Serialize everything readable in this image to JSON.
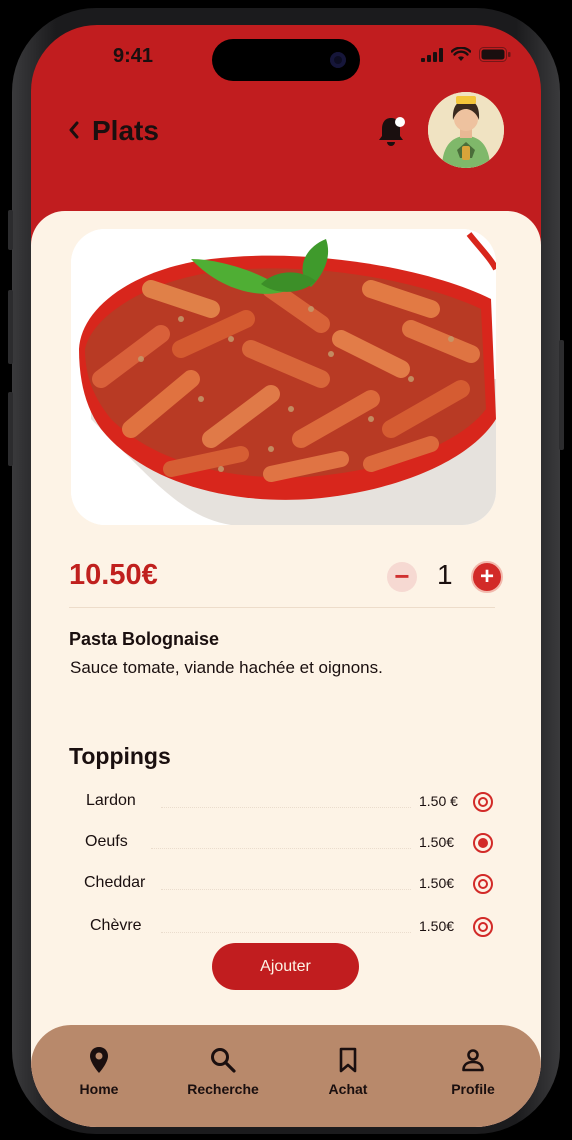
{
  "status_bar": {
    "time": "9:41"
  },
  "header": {
    "back_icon": "chevron-left-icon",
    "title": "Plats",
    "notification_icon": "bell-icon"
  },
  "dish": {
    "price": "10.50€",
    "quantity": "1",
    "name": "Pasta Bolognaise",
    "description": "Sauce tomate, viande hachée et oignons.",
    "image": "penne-bolognese-bowl"
  },
  "toppings": {
    "title": "Toppings",
    "items": [
      {
        "name": "Lardon",
        "price": "1.50 €",
        "selected": false
      },
      {
        "name": "Oeufs",
        "price": "1.50€",
        "selected": true
      },
      {
        "name": "Cheddar",
        "price": "1.50€",
        "selected": false
      },
      {
        "name": "Chèvre",
        "price": "1.50€",
        "selected": false
      }
    ]
  },
  "add_button": {
    "label": "Ajouter"
  },
  "nav": {
    "items": [
      {
        "label": "Home",
        "icon": "location-pin-icon"
      },
      {
        "label": "Recherche",
        "icon": "search-icon"
      },
      {
        "label": "Achat",
        "icon": "bookmark-icon"
      },
      {
        "label": "Profile",
        "icon": "person-icon"
      }
    ]
  },
  "colors": {
    "primary": "#c11d1f",
    "card_bg": "#fdf3e6",
    "nav_bg": "#b8896b",
    "text": "#1a0f0f"
  }
}
